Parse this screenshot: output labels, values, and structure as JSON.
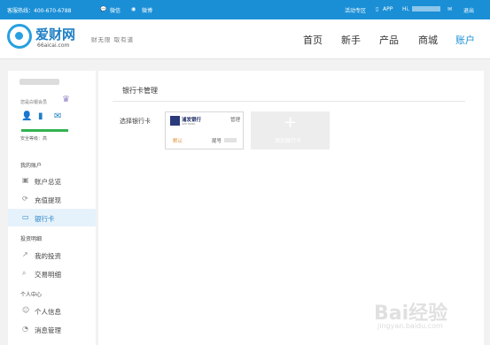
{
  "topbar": {
    "hotline": "客服热线：400-670-6788",
    "wechat": "微信",
    "weibo": "微博",
    "activity": "活动专区",
    "app": "APP",
    "greeting": "Hi,",
    "logout": "退出"
  },
  "header": {
    "logo_text": "爱财网",
    "logo_domain": "66aicai.com",
    "slogan": "财无限  取有道",
    "nav": [
      "首页",
      "新手",
      "产品",
      "商城",
      "账户"
    ],
    "nav_active_color": "#1a8fd6"
  },
  "sidebar": {
    "member_label": "您是白银会员",
    "security_label": "安全等级：高",
    "security_color": "#33b24f",
    "groups": [
      {
        "title": "我的账户",
        "items": [
          {
            "label": "账户总览",
            "icon": "account-icon"
          },
          {
            "label": "充值提现",
            "icon": "recharge-icon"
          },
          {
            "label": "银行卡",
            "icon": "card-icon",
            "active": true
          }
        ]
      },
      {
        "title": "投资明细",
        "items": [
          {
            "label": "我的投资",
            "icon": "chart-icon"
          },
          {
            "label": "交易明细",
            "icon": "search-icon"
          }
        ]
      },
      {
        "title": "个人中心",
        "items": [
          {
            "label": "个人信息",
            "icon": "user-icon"
          },
          {
            "label": "消息管理",
            "icon": "bell-icon"
          }
        ]
      }
    ]
  },
  "main": {
    "title": "银行卡管理",
    "choose_label": "选择银行卡",
    "card": {
      "bank_name": "浦发银行",
      "bank_en": "SPD BANK",
      "manage": "管理",
      "default": "默认",
      "tail_label": "尾号"
    },
    "add_card": {
      "plus": "+",
      "label": "添加银行卡"
    }
  },
  "watermark": {
    "brand": "Bai经验",
    "url": "jingyan.baidu.com"
  }
}
